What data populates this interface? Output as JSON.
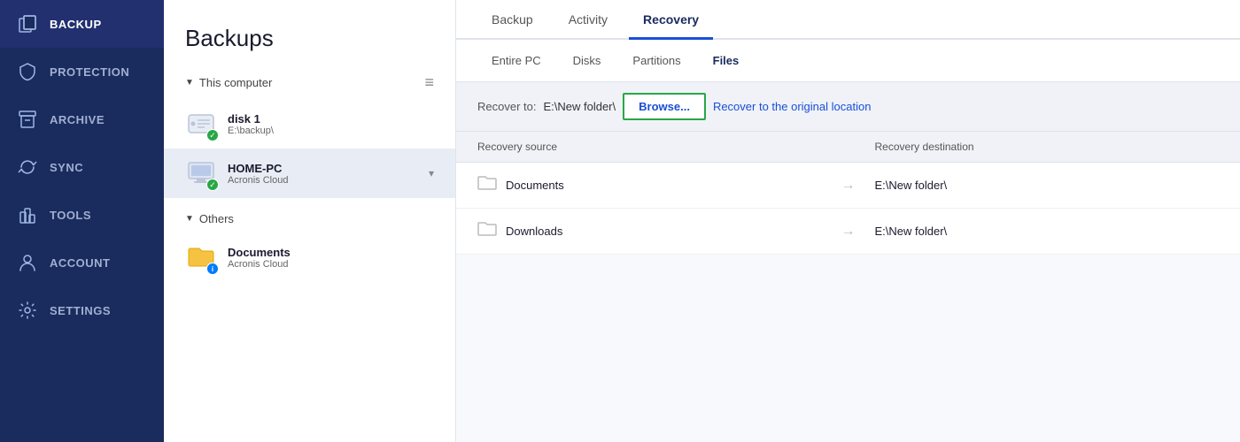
{
  "sidebar": {
    "items": [
      {
        "id": "backup",
        "label": "BACKUP",
        "icon": "copy"
      },
      {
        "id": "protection",
        "label": "PROTECTION",
        "icon": "shield"
      },
      {
        "id": "archive",
        "label": "ARCHIVE",
        "icon": "archive"
      },
      {
        "id": "sync",
        "label": "SYNC",
        "icon": "sync"
      },
      {
        "id": "tools",
        "label": "TOOLS",
        "icon": "tools"
      },
      {
        "id": "account",
        "label": "ACCOUNT",
        "icon": "account"
      },
      {
        "id": "settings",
        "label": "SETTINGS",
        "icon": "gear"
      }
    ]
  },
  "middle": {
    "title": "Backups",
    "this_computer_label": "This computer",
    "others_label": "Others",
    "devices": [
      {
        "id": "disk1",
        "name": "disk 1",
        "sub": "E:\\backup\\",
        "badge": "check",
        "section": "this_computer"
      },
      {
        "id": "home-pc",
        "name": "HOME-PC",
        "sub": "Acronis Cloud",
        "badge": "check",
        "section": "this_computer",
        "active": true,
        "hasChevron": true
      },
      {
        "id": "documents",
        "name": "Documents",
        "sub": "Acronis Cloud",
        "badge": "info",
        "section": "others"
      }
    ]
  },
  "main": {
    "tabs": [
      {
        "id": "backup",
        "label": "Backup"
      },
      {
        "id": "activity",
        "label": "Activity"
      },
      {
        "id": "recovery",
        "label": "Recovery",
        "active": true
      }
    ],
    "sub_tabs": [
      {
        "id": "entire-pc",
        "label": "Entire PC"
      },
      {
        "id": "disks",
        "label": "Disks"
      },
      {
        "id": "partitions",
        "label": "Partitions"
      },
      {
        "id": "files",
        "label": "Files",
        "active": true
      }
    ],
    "recover_bar": {
      "label": "Recover to:",
      "path": "E:\\New folder\\",
      "browse_label": "Browse...",
      "original_label": "Recover to the original location"
    },
    "table": {
      "col_source": "Recovery source",
      "col_dest": "Recovery destination",
      "rows": [
        {
          "source": "Documents",
          "dest": "E:\\New folder\\"
        },
        {
          "source": "Downloads",
          "dest": "E:\\New folder\\"
        }
      ]
    }
  }
}
